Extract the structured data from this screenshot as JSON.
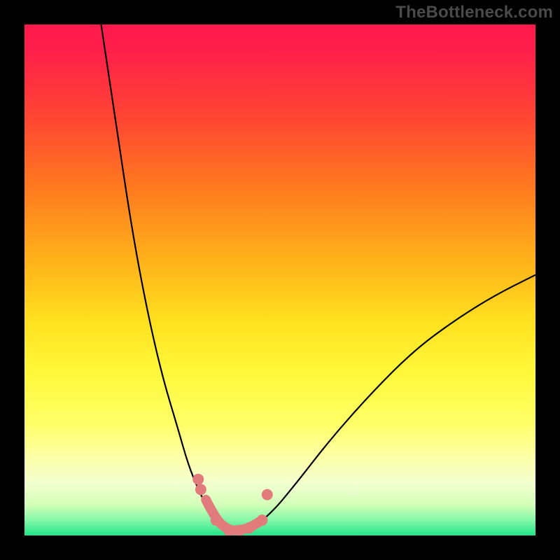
{
  "watermark": "TheBottleneck.com",
  "chart_data": {
    "type": "line",
    "title": "",
    "subtitle": "",
    "xlabel": "",
    "ylabel": "",
    "xlim": [
      0,
      100
    ],
    "ylim": [
      0,
      100
    ],
    "grid": false,
    "legend": "",
    "gradient_stops": [
      {
        "pos": 0.0,
        "color": "#ff1a4d"
      },
      {
        "pos": 0.05,
        "color": "#ff1f4b"
      },
      {
        "pos": 0.18,
        "color": "#ff4433"
      },
      {
        "pos": 0.32,
        "color": "#ff7a1f"
      },
      {
        "pos": 0.46,
        "color": "#ffb11a"
      },
      {
        "pos": 0.58,
        "color": "#ffe01f"
      },
      {
        "pos": 0.68,
        "color": "#fff83a"
      },
      {
        "pos": 0.78,
        "color": "#ffff66"
      },
      {
        "pos": 0.85,
        "color": "#fdffaa"
      },
      {
        "pos": 0.9,
        "color": "#f2ffd0"
      },
      {
        "pos": 0.94,
        "color": "#d2ffb8"
      },
      {
        "pos": 0.97,
        "color": "#85f7a8"
      },
      {
        "pos": 1.0,
        "color": "#22e58a"
      }
    ],
    "series": [
      {
        "name": "left-curve",
        "color": "#000000",
        "kind": "curve",
        "points": [
          {
            "x": 15,
            "y": 100
          },
          {
            "x": 18,
            "y": 80
          },
          {
            "x": 21,
            "y": 60
          },
          {
            "x": 24,
            "y": 44
          },
          {
            "x": 27,
            "y": 31
          },
          {
            "x": 30,
            "y": 21
          },
          {
            "x": 32,
            "y": 14
          },
          {
            "x": 34,
            "y": 9
          },
          {
            "x": 36,
            "y": 5
          },
          {
            "x": 38,
            "y": 2
          },
          {
            "x": 40,
            "y": 0.8
          }
        ]
      },
      {
        "name": "right-curve",
        "color": "#000000",
        "kind": "curve",
        "points": [
          {
            "x": 44,
            "y": 0.8
          },
          {
            "x": 48,
            "y": 4
          },
          {
            "x": 53,
            "y": 10
          },
          {
            "x": 60,
            "y": 19
          },
          {
            "x": 68,
            "y": 28
          },
          {
            "x": 76,
            "y": 36
          },
          {
            "x": 84,
            "y": 42
          },
          {
            "x": 92,
            "y": 47
          },
          {
            "x": 100,
            "y": 51
          }
        ]
      },
      {
        "name": "accent-segment",
        "color": "#e27b7b",
        "kind": "thick-curve",
        "points": [
          {
            "x": 35.5,
            "y": 7
          },
          {
            "x": 37.5,
            "y": 3
          },
          {
            "x": 40,
            "y": 1
          },
          {
            "x": 42,
            "y": 1
          },
          {
            "x": 44,
            "y": 1.5
          },
          {
            "x": 46.5,
            "y": 3
          }
        ]
      },
      {
        "name": "accent-markers",
        "color": "#e27b7b",
        "kind": "scatter",
        "points": [
          {
            "x": 34,
            "y": 11
          },
          {
            "x": 34.5,
            "y": 9
          },
          {
            "x": 37.5,
            "y": 3
          },
          {
            "x": 40,
            "y": 1
          },
          {
            "x": 42,
            "y": 1
          },
          {
            "x": 44,
            "y": 1.5
          },
          {
            "x": 46.5,
            "y": 3
          },
          {
            "x": 47.5,
            "y": 8
          }
        ]
      }
    ]
  }
}
